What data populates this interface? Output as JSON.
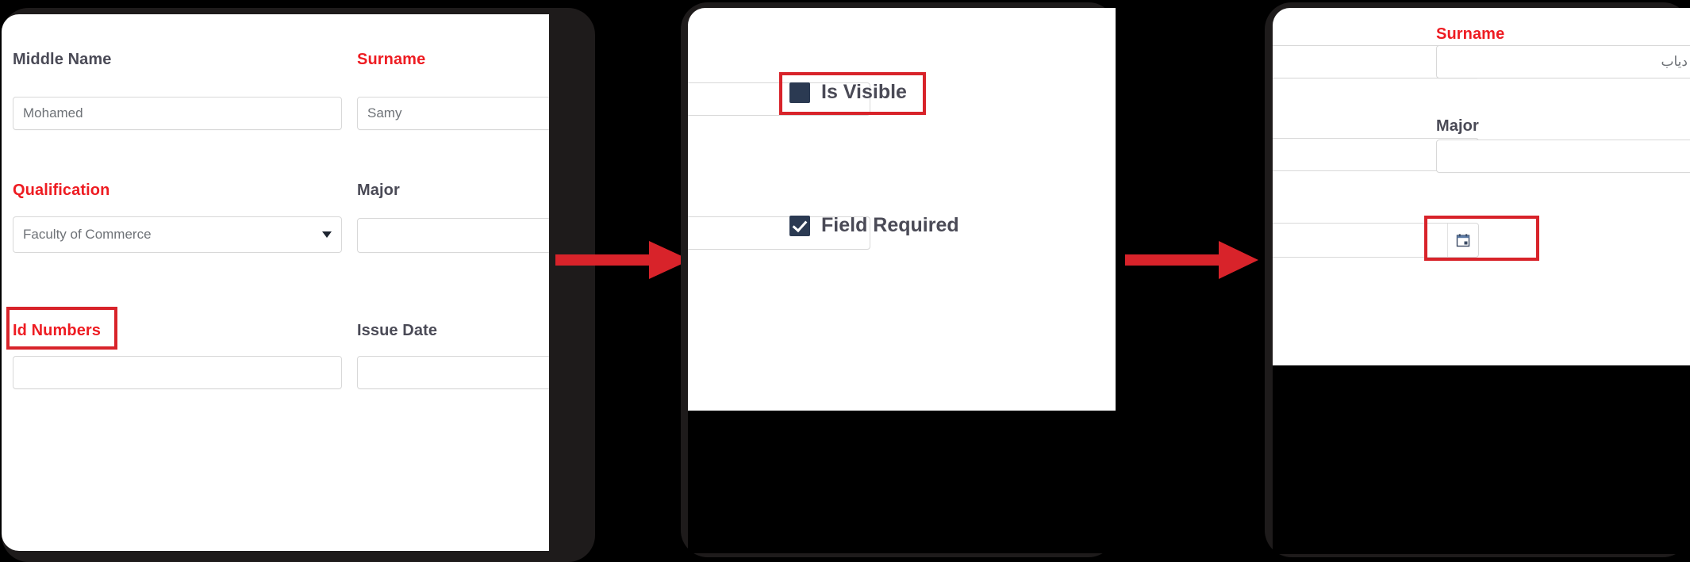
{
  "theme": {
    "accent_red": "#ee1c22",
    "highlight_red": "#d8232a",
    "checkbox_navy": "#2b3a52",
    "label_gray": "#4a4a56",
    "placeholder_gray": "#6e7277",
    "frame_dark": "#1e1b1b",
    "page_background": "#000000"
  },
  "panels": [
    {
      "id": "panel-left",
      "name": "student-form-english",
      "fields": [
        {
          "label": "Middle Name",
          "required": false,
          "value": "Mohamed",
          "control": "text"
        },
        {
          "label": "Surname",
          "required": true,
          "value": "Samy",
          "control": "text"
        },
        {
          "label": "Qualification",
          "required": true,
          "value": "Faculty of Commerce",
          "control": "select"
        },
        {
          "label": "Major",
          "required": false,
          "value": "",
          "control": "text"
        },
        {
          "label": "Id Numbers",
          "required": true,
          "value": "",
          "control": "text"
        },
        {
          "label": "Issue Date",
          "required": false,
          "value": "",
          "control": "text"
        }
      ],
      "highlight": {
        "target": "Id Numbers"
      }
    },
    {
      "id": "panel-middle",
      "name": "field-settings-checkboxes",
      "checkboxes": [
        {
          "label": "Is Visible",
          "state": "indeterminate",
          "icon": "filled-square-checkbox-icon"
        },
        {
          "label": "Field Required",
          "state": "checked",
          "icon": "checkmark-checkbox-icon"
        }
      ],
      "highlight": {
        "target": "Is Visible"
      }
    },
    {
      "id": "panel-right",
      "name": "student-form-arabic",
      "fields": [
        {
          "label": "Surname",
          "required": true,
          "value": "دياب",
          "control": "text-rtl"
        },
        {
          "label": "Major",
          "required": false,
          "value": "",
          "control": "text"
        }
      ],
      "select_placeholder": "",
      "date_icon": "calendar-icon",
      "highlight": {
        "target": "empty-field-area"
      }
    }
  ],
  "arrows": [
    {
      "name": "flow-arrow-1",
      "direction": "right",
      "color": "#d8232a"
    },
    {
      "name": "flow-arrow-2",
      "direction": "right",
      "color": "#d8232a"
    }
  ]
}
